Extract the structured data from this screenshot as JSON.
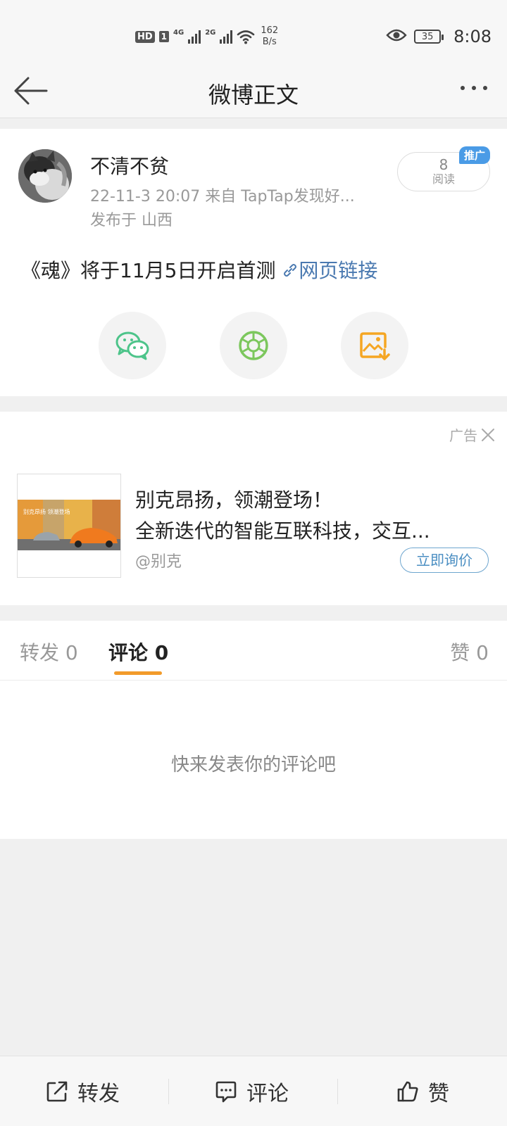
{
  "status_bar": {
    "hd": "HD",
    "sim": "1",
    "net1": "4G",
    "net2": "2G",
    "speed_value": "162",
    "speed_unit": "B/s",
    "battery": "35",
    "time": "8:08"
  },
  "header": {
    "title": "微博正文"
  },
  "post": {
    "author": "不清不贫",
    "meta": "22-11-3 20:07   来自 TapTap发现好...",
    "location": "发布于 山西",
    "read_count": "8",
    "read_label": "阅读",
    "promo_tag": "推广",
    "text": "《魂》将于11月5日开启首测 ",
    "link_text": "网页链接",
    "share_icons": [
      "wechat-icon",
      "moments-icon",
      "save-image-icon"
    ],
    "colors": {
      "link": "#4a79b0",
      "wechat": "#4dc48a",
      "moments": "#7cc75d",
      "save": "#f5a623"
    }
  },
  "ad": {
    "label": "广告",
    "title": "别克昂扬，领潮登场！",
    "desc": "全新迭代的智能互联科技，交互...",
    "account": "@别克",
    "cta": "立即询价",
    "thumb_text": "别克昂扬 领潮登场"
  },
  "tabs": {
    "repost": "转发 0",
    "comment": "评论 0",
    "like": "赞 0",
    "empty_hint": "快来发表你的评论吧",
    "accent": "#f29b2b"
  },
  "bottom_bar": {
    "repost": "转发",
    "comment": "评论",
    "like": "赞"
  }
}
